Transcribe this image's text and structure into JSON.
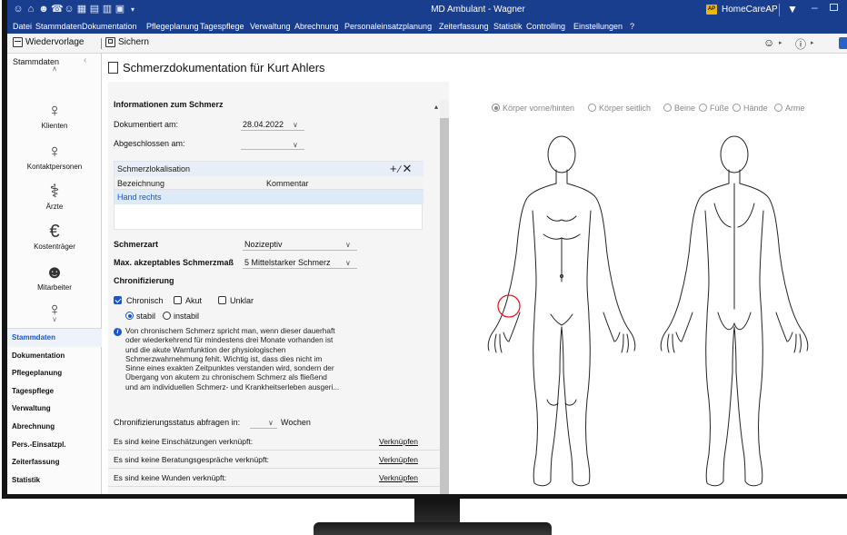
{
  "window": {
    "title": "MD Ambulant - Wagner",
    "tenant": "HomeCareAP",
    "tenant_badge": "AP"
  },
  "menu": [
    "Datei",
    "Stammdaten",
    "Dokumentation",
    "Pflegeplanung",
    "Tagespflege",
    "Verwaltung",
    "Abrechnung",
    "Personaleinsatzplanung",
    "Zeiterfassung",
    "Statistik",
    "Controlling",
    "Einstellungen",
    "?"
  ],
  "toolbar": {
    "wiedervorlage": "Wiedervorlage",
    "sichern": "Sichern"
  },
  "sidebar": {
    "title": "Stammdaten",
    "modules": [
      {
        "label": "Klienten",
        "icon": "person-icon"
      },
      {
        "label": "Kontaktpersonen",
        "icon": "contacts-icon"
      },
      {
        "label": "Ärzte",
        "icon": "doctor-icon"
      },
      {
        "label": "Kostenträger",
        "icon": "payer-icon"
      },
      {
        "label": "Mitarbeiter",
        "icon": "employee-icon"
      },
      {
        "label": "",
        "icon": "question-person-icon"
      }
    ],
    "sections": [
      "Stammdaten",
      "Dokumentation",
      "Pflegeplanung",
      "Tagespflege",
      "Verwaltung",
      "Abrechnung",
      "Pers.-Einsatzpl.",
      "Zeiterfassung",
      "Statistik"
    ],
    "active_section": "Stammdaten"
  },
  "page": {
    "title": "Schmerzdokumentation für Kurt Ahlers"
  },
  "form": {
    "info_header": "Informationen zum Schmerz",
    "documented_label": "Dokumentiert am:",
    "documented_value": "28.04.2022",
    "closed_label": "Abgeschlossen am:",
    "closed_value": "",
    "localisation": {
      "header": "Schmerzlokalisation",
      "col_name": "Bezeichnung",
      "col_comment": "Kommentar",
      "rows": [
        {
          "name": "Hand rechts",
          "comment": ""
        }
      ]
    },
    "pain_type_label": "Schmerzart",
    "pain_type_value": "Nozizeptiv",
    "max_pain_label": "Max. akzeptables Schmerzmaß",
    "max_pain_value": "5 Mittelstarker Schmerz",
    "chron_header": "Chronifizierung",
    "chron_options": {
      "chronic": "Chronisch",
      "acute": "Akut",
      "unclear": "Unklar"
    },
    "chron_checked": {
      "chronic": true,
      "acute": false,
      "unclear": false
    },
    "stability": {
      "stable": "stabil",
      "unstable": "instabil",
      "selected": "stabil"
    },
    "info_lines": [
      "Von chronischem Schmerz spricht man, wenn dieser dauerhaft",
      "oder wiederkehrend für mindestens drei Monate vorhanden ist",
      "und die akute Warnfunktion der physiologischen",
      "Schmerzwahrnehmung fehlt. Wichtig ist, dass dies nicht im",
      "Sinne eines exakten Zeitpunktes verstanden wird, sondern der",
      "Übergang von akutem zu chronischem Schmerz als fließend",
      "und am individuellen Schmerz- und Krankheitserleben ausgeri..."
    ],
    "status_query_label": "Chronifizierungsstatus abfragen in:",
    "status_query_value": "",
    "status_query_unit": "Wochen",
    "links": [
      {
        "label": "Es sind keine Einschätzungen verknüpft:",
        "action": "Verknüpfen"
      },
      {
        "label": "Es sind keine Beratungsgespräche verknüpft:",
        "action": "Verknüpfen"
      },
      {
        "label": "Es sind keine Wunden verknüpft:",
        "action": "Verknüpfen"
      }
    ]
  },
  "body_view": {
    "options": [
      "Körper vorne/hinten",
      "Körper seitlich",
      "Beine",
      "Füße",
      "Hände",
      "Arme"
    ],
    "selected": "Körper vorne/hinten",
    "marker_region": "Hand rechts",
    "marker_color": "#e02020"
  },
  "colors": {
    "titlebar": "#1a3e8e",
    "accent": "#1a56c8",
    "badge": "#f2b600"
  }
}
